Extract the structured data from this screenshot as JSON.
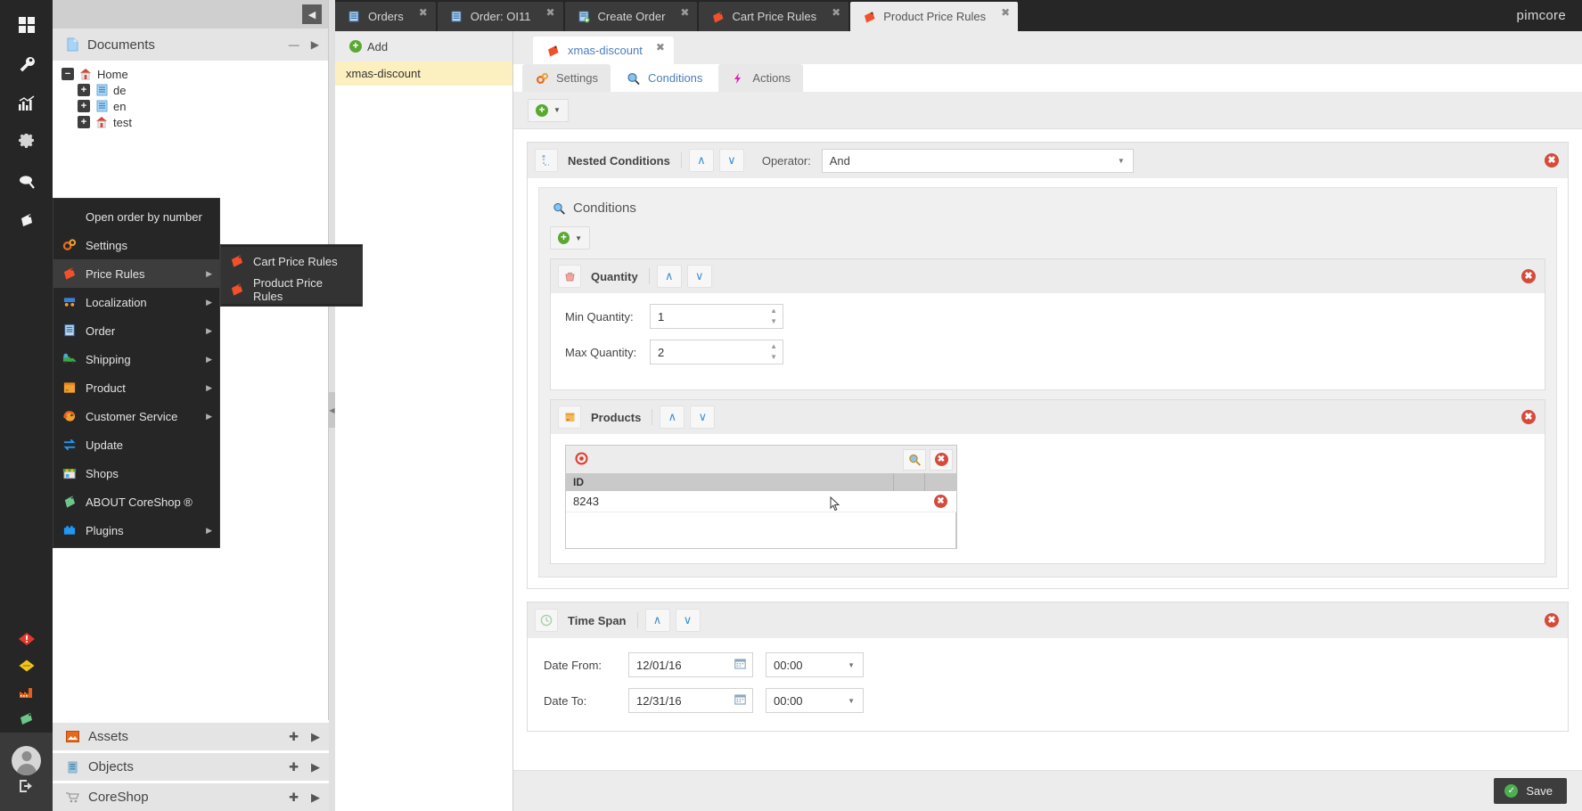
{
  "rail": {
    "icons": [
      {
        "name": "dashboard-icon",
        "glyph": "▦"
      },
      {
        "name": "tools-icon",
        "glyph": "🔧"
      },
      {
        "name": "marketing-icon",
        "glyph": "📊"
      },
      {
        "name": "settings-icon",
        "glyph": "⚙"
      },
      {
        "name": "search-icon",
        "glyph": "🔍"
      },
      {
        "name": "coreshop-tag-icon",
        "glyph": "🏷"
      }
    ],
    "status_icons": [
      {
        "name": "alert-icon",
        "glyph": "❗"
      },
      {
        "name": "warning-icon",
        "glyph": "◆"
      },
      {
        "name": "factory-icon",
        "glyph": "🏭"
      },
      {
        "name": "green-tag-icon",
        "glyph": "🏷"
      }
    ],
    "user": {
      "avatar_name": "avatar",
      "logout_glyph": "⇥"
    }
  },
  "left_panel": {
    "collapse_glyph": "◀",
    "title": "Documents",
    "title_icon": "document-icon",
    "minimize_glyph": "—",
    "expand_glyph": "▶",
    "tree": [
      {
        "label": "Home",
        "expander": "−",
        "icon": "home-icon",
        "indent": 0
      },
      {
        "label": "de",
        "expander": "+",
        "icon": "page-icon",
        "indent": 1
      },
      {
        "label": "en",
        "expander": "+",
        "icon": "page-icon",
        "indent": 1
      },
      {
        "label": "test",
        "expander": "+",
        "icon": "home-icon",
        "indent": 1
      }
    ],
    "bottom_panels": [
      {
        "label": "Assets",
        "icon": "assets-icon",
        "add_glyph": "✚",
        "expand_glyph": "▶"
      },
      {
        "label": "Objects",
        "icon": "objects-icon",
        "add_glyph": "✚",
        "expand_glyph": "▶"
      },
      {
        "label": "CoreShop",
        "icon": "cart-icon",
        "add_glyph": "✚",
        "expand_glyph": "▶"
      }
    ]
  },
  "context_menu": {
    "items": [
      {
        "label": "Open order by number",
        "icon": null,
        "has_submenu": false,
        "active": false
      },
      {
        "label": "Settings",
        "icon": "gears-icon",
        "has_submenu": false,
        "active": false
      },
      {
        "label": "Price Rules",
        "icon": "price-tag-icon",
        "has_submenu": true,
        "active": true
      },
      {
        "label": "Localization",
        "icon": "localization-icon",
        "has_submenu": true,
        "active": false
      },
      {
        "label": "Order",
        "icon": "order-icon",
        "has_submenu": true,
        "active": false
      },
      {
        "label": "Shipping",
        "icon": "shipping-truck-icon",
        "has_submenu": true,
        "active": false
      },
      {
        "label": "Product",
        "icon": "product-box-icon",
        "has_submenu": true,
        "active": false
      },
      {
        "label": "Customer Service",
        "icon": "headset-icon",
        "has_submenu": true,
        "active": false
      },
      {
        "label": "Update",
        "icon": "update-arrows-icon",
        "has_submenu": false,
        "active": false
      },
      {
        "label": "Shops",
        "icon": "shop-icon",
        "has_submenu": false,
        "active": false
      },
      {
        "label": "ABOUT CoreShop ®",
        "icon": "green-tag-icon",
        "has_submenu": false,
        "active": false
      },
      {
        "label": "Plugins",
        "icon": "plugins-icon",
        "has_submenu": true,
        "active": false
      }
    ],
    "submenu": {
      "items": [
        {
          "label": "Cart Price Rules",
          "icon": "price-tag-icon"
        },
        {
          "label": "Product Price Rules",
          "icon": "price-tag-icon"
        }
      ]
    }
  },
  "topbar": {
    "brand": "pimcore",
    "tabs": [
      {
        "label": "Orders",
        "icon": "order-list-icon",
        "active": false,
        "close_glyph": "✖"
      },
      {
        "label": "Order: OI11",
        "icon": "order-list-icon",
        "active": false,
        "close_glyph": "✖"
      },
      {
        "label": "Create Order",
        "icon": "create-order-icon",
        "active": false,
        "close_glyph": "✖"
      },
      {
        "label": "Cart Price Rules",
        "icon": "price-tag-icon",
        "active": false,
        "close_glyph": "✖"
      },
      {
        "label": "Product Price Rules",
        "icon": "price-tag-icon",
        "active": true,
        "close_glyph": "✖"
      }
    ]
  },
  "list_column": {
    "add_label": "Add",
    "add_icon": "green-plus-icon",
    "items": [
      {
        "label": "xmas-discount",
        "selected": true
      }
    ]
  },
  "editor": {
    "doc_tab": {
      "label": "xmas-discount",
      "icon": "price-tag-icon",
      "close_glyph": "✖"
    },
    "sub_tabs": [
      {
        "label": "Settings",
        "icon": "gears-icon",
        "active": false
      },
      {
        "label": "Conditions",
        "icon": "magnifier-icon",
        "active": true
      },
      {
        "label": "Actions",
        "icon": "lightning-icon",
        "active": false
      }
    ],
    "toolbar": {
      "add_icon": "green-plus-icon",
      "caret": "▼"
    },
    "nested": {
      "title": "Nested Conditions",
      "icon": "nested-icon",
      "up_glyph": "∧",
      "down_glyph": "∨",
      "operator_label": "Operator:",
      "operator_value": "And",
      "delete_glyph": "✖",
      "conditions_section_title": "Conditions",
      "conditions_section_icon": "magnifier-icon",
      "inner_add_icon": "green-plus-icon"
    },
    "quantity": {
      "title": "Quantity",
      "icon": "basket-icon",
      "up_glyph": "∧",
      "down_glyph": "∨",
      "delete_glyph": "✖",
      "min_label": "Min Quantity:",
      "min_value": "1",
      "max_label": "Max Quantity:",
      "max_value": "2"
    },
    "products": {
      "title": "Products",
      "icon": "product-box-icon",
      "up_glyph": "∧",
      "down_glyph": "∨",
      "delete_glyph": "✖",
      "grid": {
        "target_icon": "target-icon",
        "search_icon": "magnifier-icon",
        "clear_icon": "delete-icon",
        "columns": [
          "ID",
          "",
          ""
        ],
        "rows": [
          {
            "id": "8243",
            "remove_glyph": "✖"
          }
        ]
      }
    },
    "timespan": {
      "title": "Time Span",
      "icon": "clock-icon",
      "up_glyph": "∧",
      "down_glyph": "∨",
      "delete_glyph": "✖",
      "date_from_label": "Date From:",
      "date_from_value": "12/01/16",
      "time_from_value": "00:00",
      "date_to_label": "Date To:",
      "date_to_value": "12/31/16",
      "time_to_value": "00:00",
      "calendar_icon": "calendar-icon"
    },
    "footer": {
      "save_label": "Save",
      "save_icon": "check-icon"
    }
  },
  "colors": {
    "accent_red": "#e03a2f",
    "accent_blue": "#4a7ebb",
    "green": "#5aa832",
    "dark": "#262626"
  }
}
